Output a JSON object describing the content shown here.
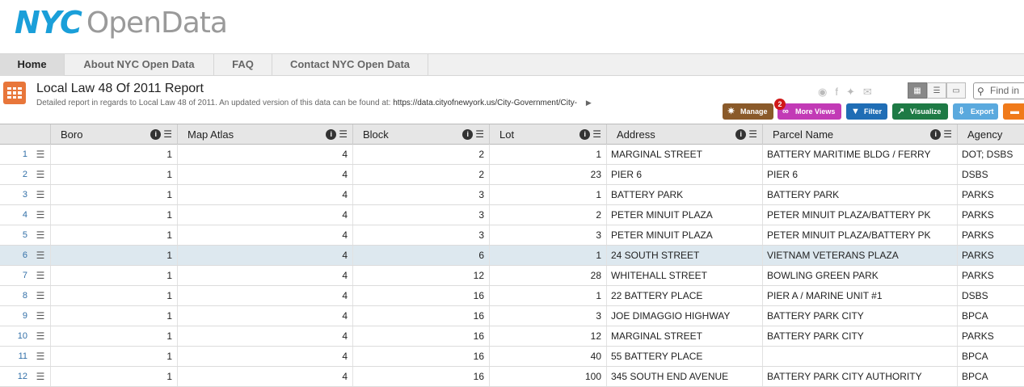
{
  "logo": {
    "nyc": "NYC",
    "opendata": "OpenData"
  },
  "nav": {
    "tabs": [
      "Home",
      "About NYC Open Data",
      "FAQ",
      "Contact NYC Open Data"
    ]
  },
  "dataset": {
    "title": "Local Law 48 Of 2011 Report",
    "description": "Detailed report in regards to Local Law 48 of 2011. An updated version of this data can be found at:",
    "link": "https://data.cityofnewyork.us/City-Government/City-",
    "icon": "table-icon"
  },
  "toolbar": {
    "find_placeholder": "Find in",
    "manage": "Manage",
    "more_views": "More Views",
    "more_views_badge": "2",
    "filter": "Filter",
    "visualize": "Visualize",
    "export": "Export"
  },
  "table": {
    "columns": [
      "Boro",
      "Map Atlas",
      "Block",
      "Lot",
      "Address",
      "Parcel Name",
      "Agency"
    ],
    "rows": [
      [
        "1",
        "1",
        "4",
        "2",
        "1",
        "MARGINAL STREET",
        "BATTERY MARITIME BLDG / FERRY",
        "DOT; DSBS"
      ],
      [
        "2",
        "1",
        "4",
        "2",
        "23",
        "PIER 6",
        "PIER 6",
        "DSBS"
      ],
      [
        "3",
        "1",
        "4",
        "3",
        "1",
        "BATTERY PARK",
        "BATTERY PARK",
        "PARKS"
      ],
      [
        "4",
        "1",
        "4",
        "3",
        "2",
        "PETER MINUIT PLAZA",
        "PETER MINUIT PLAZA/BATTERY PK",
        "PARKS"
      ],
      [
        "5",
        "1",
        "4",
        "3",
        "3",
        "PETER MINUIT PLAZA",
        "PETER MINUIT PLAZA/BATTERY PK",
        "PARKS"
      ],
      [
        "6",
        "1",
        "4",
        "6",
        "1",
        "24 SOUTH STREET",
        "VIETNAM VETERANS PLAZA",
        "PARKS"
      ],
      [
        "7",
        "1",
        "4",
        "12",
        "28",
        "WHITEHALL STREET",
        "BOWLING GREEN PARK",
        "PARKS"
      ],
      [
        "8",
        "1",
        "4",
        "16",
        "1",
        "22 BATTERY PLACE",
        "PIER A / MARINE UNIT #1",
        "DSBS"
      ],
      [
        "9",
        "1",
        "4",
        "16",
        "3",
        "JOE DIMAGGIO HIGHWAY",
        "BATTERY PARK CITY",
        "BPCA"
      ],
      [
        "10",
        "1",
        "4",
        "16",
        "12",
        "MARGINAL STREET",
        "BATTERY PARK CITY",
        "PARKS"
      ],
      [
        "11",
        "1",
        "4",
        "16",
        "40",
        "55 BATTERY PLACE",
        "",
        "BPCA"
      ],
      [
        "12",
        "1",
        "4",
        "16",
        "100",
        "345 SOUTH END AVENUE",
        "BATTERY PARK CITY AUTHORITY",
        "BPCA"
      ]
    ]
  }
}
